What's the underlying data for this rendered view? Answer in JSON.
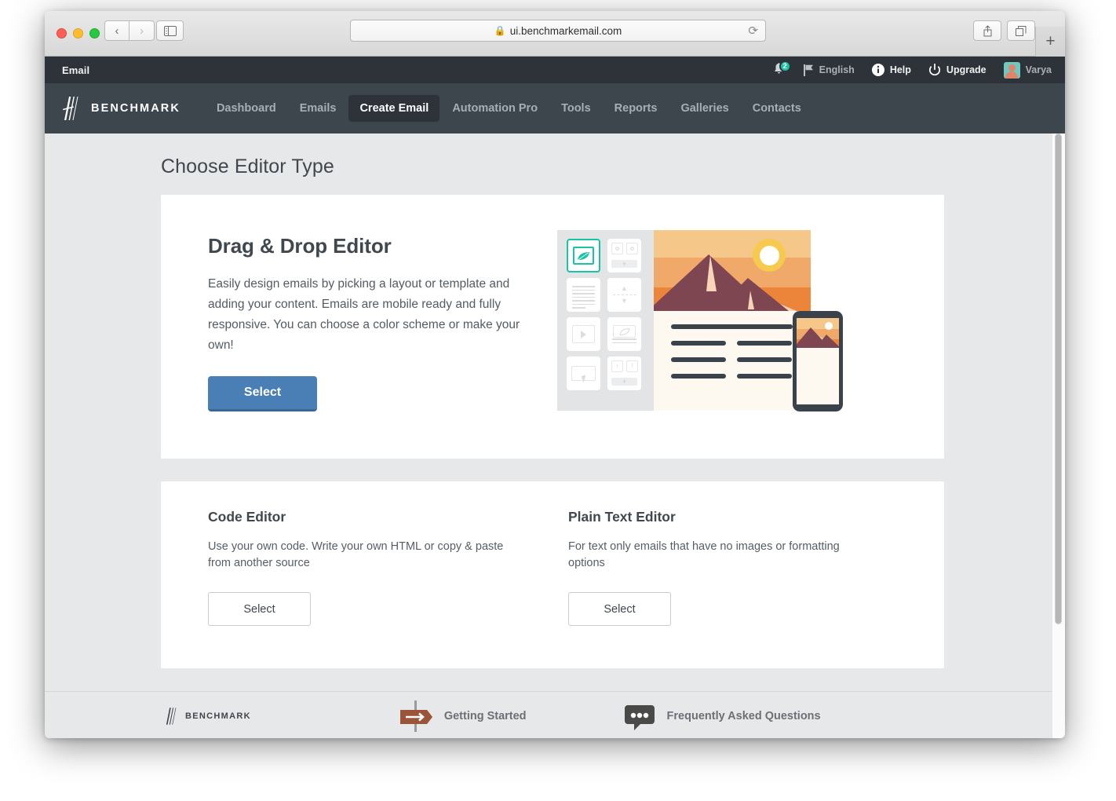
{
  "browser": {
    "url": "ui.benchmarkemail.com",
    "lock_icon": "lock-icon",
    "back_glyph": "‹",
    "forward_glyph": "›",
    "reload_glyph": "⟳",
    "new_tab_glyph": "+"
  },
  "utility_bar": {
    "app_label": "Email",
    "notifications": {
      "icon": "bell-icon",
      "count": "2"
    },
    "language": {
      "icon": "flag-icon",
      "label": "English"
    },
    "help": {
      "icon": "info-icon",
      "label": "Help"
    },
    "upgrade": {
      "icon": "power-icon",
      "label": "Upgrade"
    },
    "user": {
      "icon": "avatar",
      "name": "Varya"
    }
  },
  "main_nav": {
    "brand": "BENCHMARK",
    "items": [
      {
        "label": "Dashboard",
        "active": false
      },
      {
        "label": "Emails",
        "active": false
      },
      {
        "label": "Create Email",
        "active": true
      },
      {
        "label": "Automation Pro",
        "active": false
      },
      {
        "label": "Tools",
        "active": false
      },
      {
        "label": "Reports",
        "active": false
      },
      {
        "label": "Galleries",
        "active": false
      },
      {
        "label": "Contacts",
        "active": false
      }
    ]
  },
  "page": {
    "title": "Choose Editor Type",
    "drag_drop": {
      "title": "Drag & Drop Editor",
      "body": "Easily design emails by picking a layout or template and adding your content. Emails are mobile ready and fully responsive. You can choose a color scheme or make your own!",
      "select_label": "Select"
    },
    "code_editor": {
      "title": "Code Editor",
      "body": "Use your own code. Write your own HTML or copy & paste from another source",
      "select_label": "Select"
    },
    "plain_text_editor": {
      "title": "Plain Text Editor",
      "body": "For text only emails that have no images or formatting options",
      "select_label": "Select"
    }
  },
  "footer": {
    "brand": "BENCHMARK",
    "getting_started": "Getting Started",
    "faq": "Frequently Asked Questions"
  },
  "colors": {
    "nav_bg": "#3d454d",
    "utility_bg": "#2e3339",
    "page_bg": "#e7e8ea",
    "primary_button": "#4a7fb5",
    "accent_teal": "#17c5a5"
  }
}
